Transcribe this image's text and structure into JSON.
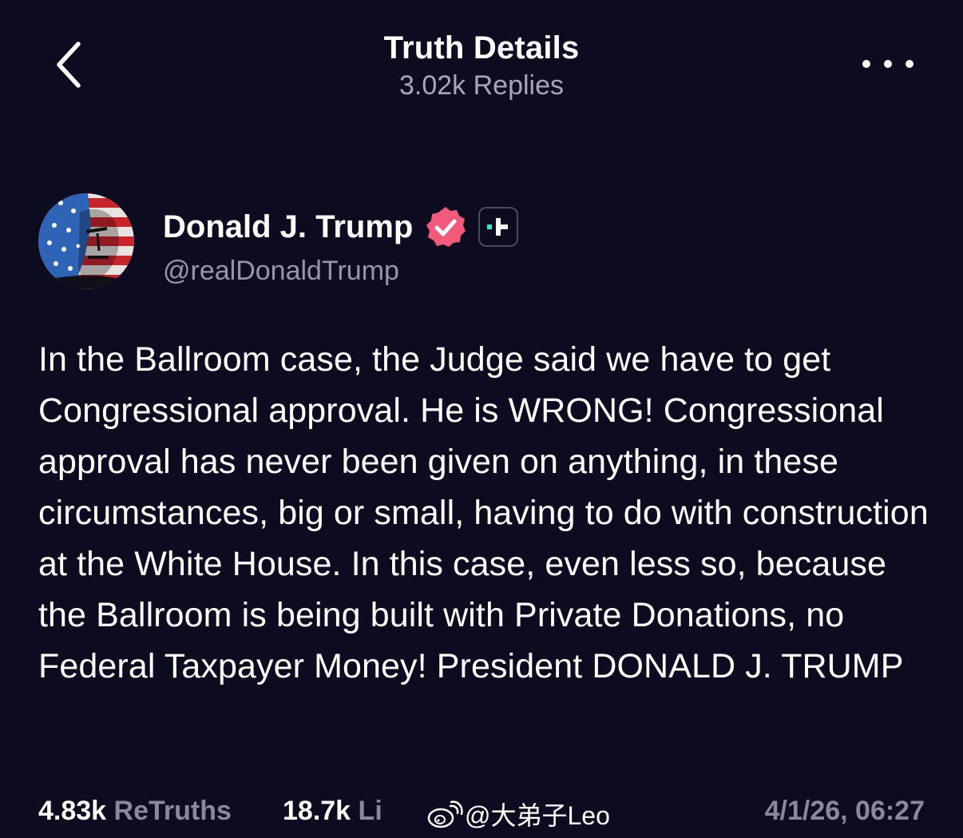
{
  "header": {
    "title": "Truth Details",
    "subtitle": "3.02k Replies",
    "back_icon": "chevron-left-icon",
    "more_icon": "more-horizontal-icon"
  },
  "author": {
    "display_name": "Donald J. Trump",
    "handle": "@realDonaldTrump",
    "verified_badge_icon": "verified-check-icon",
    "verified_badge_color": "#f25a7c",
    "plus_badge_icon": "plus-icon",
    "plus_badge_accent": "#3ee6c4",
    "avatar_description_icon": "avatar-flag-portrait"
  },
  "post": {
    "text": "In the Ballroom case, the Judge said we have to get Congressional approval. He is WRONG! Congressional approval has never been given on anything, in these circumstances, big or small, having to do with construction at the White House. In this case, even less so, because the Ballroom is being built with Private Donations, no Federal Taxpayer Money! President DONALD J. TRUMP"
  },
  "stats": {
    "retruths_count": "4.83k",
    "retruths_label": "ReTruths",
    "likes_count": "18.7k",
    "likes_label": "Li",
    "timestamp": "4/1/26, 06:27"
  },
  "watermark": {
    "text": "@大弟子Leo",
    "icon": "weibo-icon"
  },
  "colors": {
    "background": "#0c0b1f",
    "muted_text": "#8a899c"
  }
}
